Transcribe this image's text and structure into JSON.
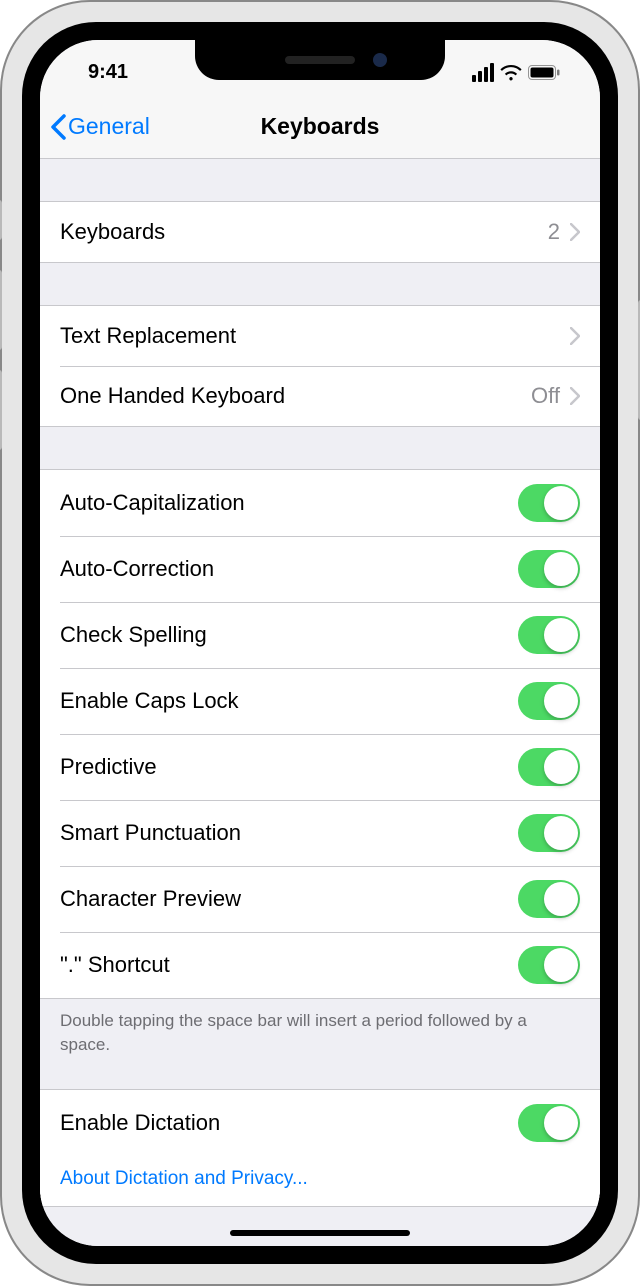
{
  "status": {
    "time": "9:41"
  },
  "nav": {
    "back": "General",
    "title": "Keyboards"
  },
  "group1": {
    "keyboards": {
      "label": "Keyboards",
      "value": "2"
    }
  },
  "group2": {
    "textReplacement": {
      "label": "Text Replacement"
    },
    "oneHanded": {
      "label": "One Handed Keyboard",
      "value": "Off"
    }
  },
  "group3": {
    "items": [
      {
        "label": "Auto-Capitalization",
        "on": true
      },
      {
        "label": "Auto-Correction",
        "on": true
      },
      {
        "label": "Check Spelling",
        "on": true
      },
      {
        "label": "Enable Caps Lock",
        "on": true
      },
      {
        "label": "Predictive",
        "on": true
      },
      {
        "label": "Smart Punctuation",
        "on": true
      },
      {
        "label": "Character Preview",
        "on": true
      },
      {
        "label": "\".\" Shortcut",
        "on": true
      }
    ],
    "footer": "Double tapping the space bar will insert a period followed by a space."
  },
  "group4": {
    "dictation": {
      "label": "Enable Dictation",
      "on": true
    },
    "link": "About Dictation and Privacy..."
  }
}
